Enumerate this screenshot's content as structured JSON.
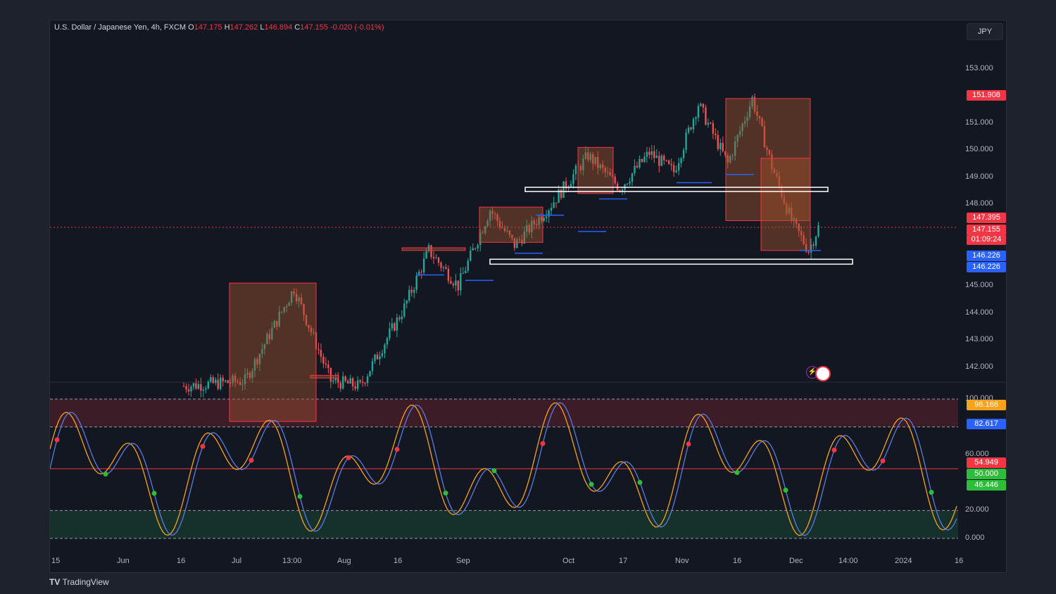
{
  "header": {
    "symbol_title": "U.S. Dollar / Japanese Yen, 4h, FXCM",
    "ohlc": [
      {
        "k": "O",
        "v": "147.175"
      },
      {
        "k": "H",
        "v": "147.262"
      },
      {
        "k": "L",
        "v": "146.894"
      },
      {
        "k": "C",
        "v": "147.155"
      }
    ],
    "change": "-0.020 (-0.01%)"
  },
  "currency": "JPY",
  "footer": {
    "brand": "TradingView"
  },
  "price_axis": [
    "153.000",
    "151.000",
    "150.000",
    "149.000",
    "148.000",
    "145.000",
    "144.000",
    "143.000",
    "142.000"
  ],
  "osc_axis": [
    "100.000",
    "60.000",
    "20.000",
    "0.000"
  ],
  "time_axis": [
    "15",
    "Jun",
    "16",
    "Jul",
    "13:00",
    "Aug",
    "16",
    "Sep",
    "Oct",
    "17",
    "Nov",
    "16",
    "Dec",
    "14:00",
    "2024",
    "16"
  ],
  "price_labels": [
    {
      "text": "151.908",
      "color": "#f23645"
    },
    {
      "text": "147.395",
      "color": "#f23645"
    },
    {
      "text": "147.155",
      "color": "#f23645"
    },
    {
      "text": "01:09:24",
      "color": "#f23645"
    },
    {
      "text": "146.226",
      "color": "#2962ff"
    },
    {
      "text": "146.226",
      "color": "#2962ff"
    }
  ],
  "osc_labels": [
    {
      "text": "96.166",
      "color": "#f7a21b"
    },
    {
      "text": "82.617",
      "color": "#2962ff"
    },
    {
      "text": "54.949",
      "color": "#f23645"
    },
    {
      "text": "50.000",
      "color": "#2ebd3a"
    },
    {
      "text": "46.446",
      "color": "#2ebd3a"
    }
  ],
  "chart_data": {
    "type": "line",
    "price_ylim": [
      141.5,
      154.0
    ],
    "osc_ylim": [
      0,
      100
    ],
    "colors": {
      "bg": "#131722",
      "up": "#26a69a",
      "down": "#ef5350",
      "k": "#f7a21b",
      "d": "#5b7be0",
      "supply": "#a0522d",
      "demand_line": "#2962ff"
    }
  }
}
